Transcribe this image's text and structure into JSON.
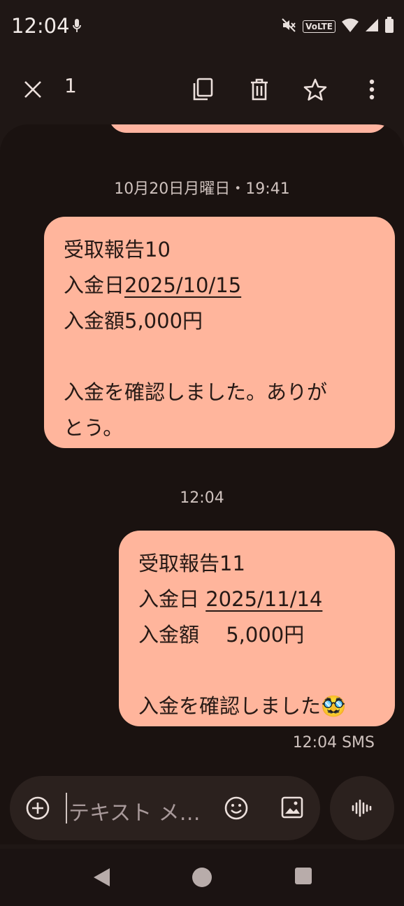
{
  "status_bar": {
    "time": "12:04",
    "volte": "VoLTE",
    "icons": [
      "mic-icon",
      "mute-icon",
      "wifi-icon",
      "signal-icon",
      "battery-icon"
    ]
  },
  "action_bar": {
    "selected_count": "1",
    "icons": [
      "close-icon",
      "copy-icon",
      "delete-icon",
      "star-icon",
      "more-icon"
    ]
  },
  "conversation": {
    "messages": [
      {
        "timestamp": "10月20日月曜日・19:41",
        "lines": [
          "受取報告10",
          "入金日",
          "2025/10/15",
          "入金額5,000円",
          "",
          "入金を確認しました。ありが",
          "とう。"
        ]
      },
      {
        "timestamp": "12:04",
        "lines": [
          "受取報告11",
          "入金日 ",
          "2025/11/14",
          "入金額　 5,000円",
          "",
          "入金を確認しました",
          "🥸"
        ],
        "meta": "12:04 SMS"
      }
    ]
  },
  "compose": {
    "placeholder": "テキスト メ…",
    "icons": [
      "add-icon",
      "emoji-icon",
      "gallery-icon",
      "voice-icon"
    ]
  },
  "colors": {
    "background": "#1f1715",
    "bubble": "#ffb59c",
    "bubble_text": "#261915",
    "compose": "#2b211e"
  }
}
